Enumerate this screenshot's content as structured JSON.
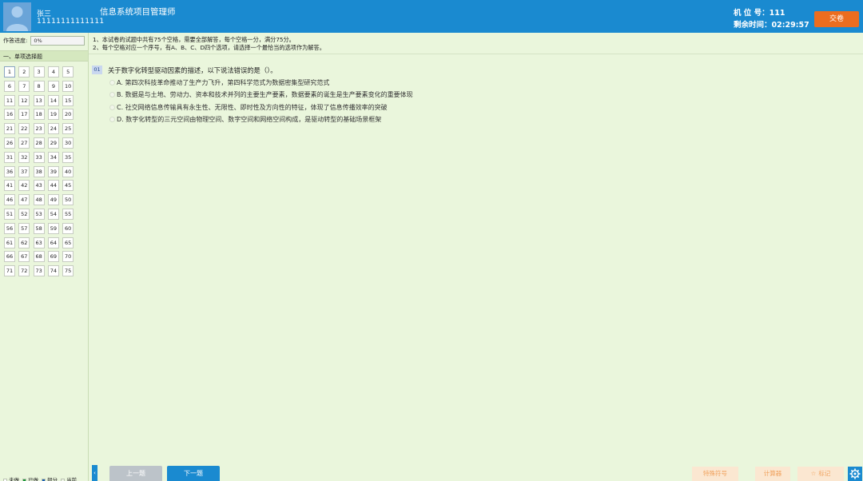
{
  "header": {
    "user_name": "张三",
    "user_id": "11111111111111",
    "exam_title": "信息系统项目管理师",
    "seat_label": "机 位 号：111",
    "time_label": "剩余时间：02:29:57",
    "submit_label": "交卷",
    "colors": {
      "header_bg": "#1a8ad0",
      "submit_bg": "#ec6d1f"
    }
  },
  "sidebar": {
    "progress_label": "作答进度:",
    "progress_value": "0%",
    "section_title": "一、单项选择题",
    "questions": [
      "1",
      "2",
      "3",
      "4",
      "5",
      "6",
      "7",
      "8",
      "9",
      "10",
      "11",
      "12",
      "13",
      "14",
      "15",
      "16",
      "17",
      "18",
      "19",
      "20",
      "21",
      "22",
      "23",
      "24",
      "25",
      "26",
      "27",
      "28",
      "29",
      "30",
      "31",
      "32",
      "33",
      "34",
      "35",
      "36",
      "37",
      "38",
      "39",
      "40",
      "41",
      "42",
      "43",
      "44",
      "45",
      "46",
      "47",
      "48",
      "49",
      "50",
      "51",
      "52",
      "53",
      "54",
      "55",
      "56",
      "57",
      "58",
      "59",
      "60",
      "61",
      "62",
      "63",
      "64",
      "65",
      "66",
      "67",
      "68",
      "69",
      "70",
      "71",
      "72",
      "73",
      "74",
      "75"
    ],
    "current_question": "1",
    "legend": [
      {
        "label": "未做",
        "color": "#ffffff"
      },
      {
        "label": "已做",
        "color": "#1a9a3a"
      },
      {
        "label": "部分",
        "color": "#1a5fb4"
      },
      {
        "label": "当前",
        "color": "#f1f6ea"
      }
    ]
  },
  "instructions": {
    "line1": "1、本试卷的试题中共有75个空格，需要全部解答，每个空格一分，满分75分。",
    "line2": "2、每个空格对应一个序号，有A、B、C、D四个选项，请选择一个最恰当的选项作为解答。"
  },
  "question": {
    "number": "01",
    "stem": "关于数字化转型驱动因素的描述，以下说法错误的是（）。",
    "options": [
      "A. 第四次科技革命推动了生产力飞升，第四科学范式为数据密集型研究范式",
      "B. 数据是与土地、劳动力、资本和技术并列的主要生产要素，数据要素的诞生是生产要素变化的重要体现",
      "C. 社交网络信息传输具有永生性、无限性、即时性及方向性的特征，体现了信息传播效率的突破",
      "D. 数字化转型的三元空间由物理空间、数字空间和网络空间构成，是驱动转型的基础场景框架"
    ]
  },
  "footer": {
    "collapse_icon": "chevron-left-icon",
    "prev_label": "上一题",
    "next_label": "下一题",
    "special_label": "特殊符号",
    "calc_label": "计算器",
    "mark_label": "标记",
    "mark_icon": "star-icon",
    "settings_icon": "gear-icon"
  }
}
